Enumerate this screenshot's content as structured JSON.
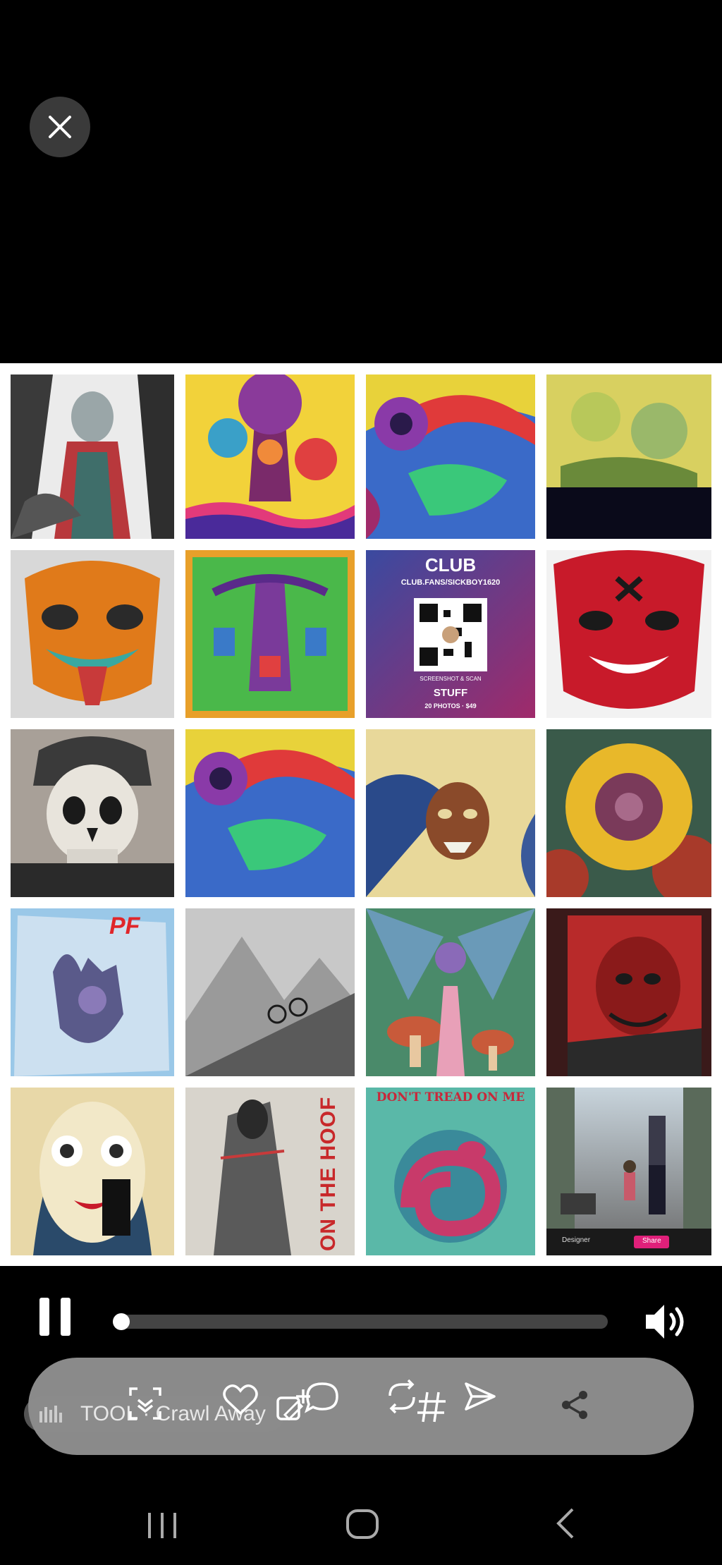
{
  "viewer": {
    "close_icon": "close-icon",
    "collage_tiles": [
      "madonna-figure-art",
      "psychedelic-tree-art",
      "eyeball-flames-art",
      "yellow-creatures-art",
      "orange-oni-mask-art",
      "green-tree-swings-art",
      "club-qr-promo",
      "red-oni-mask-art",
      "skull-helmet-art",
      "eyeball-flames-art-2",
      "blue-mask-sketch-art",
      "sunflower-art",
      "hand-sticker-art",
      "mountain-bike-sketch-art",
      "winged-mushroom-art",
      "red-demon-art",
      "clown-girl-art",
      "reaper-hoof-art",
      "dont-tread-snake-art",
      "father-daughter-art"
    ],
    "club_promo": {
      "title": "CLUB",
      "url": "CLUB.FANS/SICKBOY1620",
      "instruction": "SCREENSHOT & SCAN",
      "subtitle": "STUFF",
      "price_line": "20 PHOTOS · $49"
    },
    "tile_text": {
      "pf": "PF",
      "hoof": "ON THE HOOF",
      "dont_tread": "DON'T TREAD ON ME",
      "designer": "Designer",
      "share": "Share"
    }
  },
  "player": {
    "state": "playing",
    "progress": 0.0,
    "pause_icon": "pause-icon",
    "volume_icon": "volume-icon"
  },
  "actions": {
    "music_label": "TOOL · Crawl Away",
    "icons": [
      "scan-icon",
      "heart-icon",
      "remix-icon",
      "comment-icon",
      "repost-icon",
      "hashtag-icon",
      "send-icon",
      "share-icon"
    ]
  },
  "system_nav": {
    "icons": [
      "recents-icon",
      "home-icon",
      "back-icon"
    ]
  }
}
